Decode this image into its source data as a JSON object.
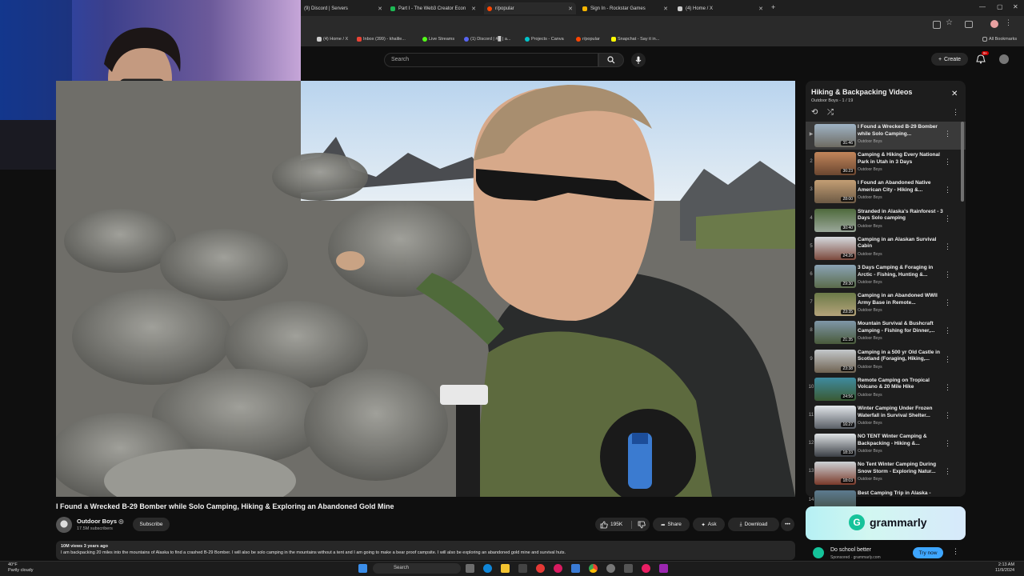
{
  "browser": {
    "tabs": [
      {
        "label": "(9) Discord | Servers",
        "color": "#5865f2"
      },
      {
        "label": "Part I - The Web3 Creator Econ",
        "color": "#1db954"
      },
      {
        "label": "r/popular",
        "color": "#ff4500"
      },
      {
        "label": "Sign In - Rockstar Games",
        "color": "#f7b500"
      },
      {
        "label": "(4) Home / X",
        "color": "#cccccc"
      }
    ],
    "bookmarks": [
      {
        "label": "(4) Home / X"
      },
      {
        "label": "Inbox (399) - khalile..."
      },
      {
        "label": "Live Streams"
      },
      {
        "label": "(1) Discord | #█ | a..."
      },
      {
        "label": "Projects - Canva"
      },
      {
        "label": "r/popular"
      },
      {
        "label": "Snapchat - Say it in..."
      }
    ],
    "all_bookmarks": "All Bookmarks"
  },
  "header": {
    "search_placeholder": "Search",
    "create_label": "Create",
    "notif_count": "9+"
  },
  "video": {
    "title": "I Found a Wrecked B-29 Bomber while Solo Camping, Hiking & Exploring an Abandoned Gold Mine",
    "channel": "Outdoor Boys",
    "subscribers": "17.5M subscribers",
    "subscribe_label": "Subscribe",
    "likes": "195K",
    "share_label": "Share",
    "ask_label": "Ask",
    "download_label": "Download",
    "stats": "10M views  3 years ago",
    "description": "I am backpacking 20 miles into the mountains of Alaska to find a crashed B-29 Bomber. I will also be solo camping in the mountains without a tent and I am going to make a bear proof campsite. I will also be exploring an abandoned gold mine and survival huts."
  },
  "playlist": {
    "title": "Hiking & Backpacking Videos",
    "subtitle": "Outdoor Boys - 1 / 19",
    "items": [
      {
        "num": "▶",
        "title": "I Found a Wrecked B-29 Bomber while Solo Camping...",
        "channel": "Outdoor Boys",
        "duration": "31:46",
        "colors": [
          "#9fb3c5",
          "#6e6b62"
        ]
      },
      {
        "num": "2",
        "title": "Camping & Hiking Every National Park in Utah in 3 Days",
        "channel": "Outdoor Boys",
        "duration": "36:23",
        "colors": [
          "#c2865b",
          "#6a4630"
        ]
      },
      {
        "num": "3",
        "title": "I Found an Abandoned Native American City - Hiking &...",
        "channel": "Outdoor Boys",
        "duration": "28:00",
        "colors": [
          "#c39e74",
          "#6d5a45"
        ]
      },
      {
        "num": "4",
        "title": "Stranded in Alaska's Rainforest - 3 Days Solo camping",
        "channel": "Outdoor Boys",
        "duration": "30:40",
        "colors": [
          "#4f6a3c",
          "#9aa79a"
        ]
      },
      {
        "num": "5",
        "title": "Camping in an Alaskan Survival Cabin",
        "channel": "Outdoor Boys",
        "duration": "24:26",
        "colors": [
          "#d5d9de",
          "#7c4a3d"
        ]
      },
      {
        "num": "6",
        "title": "3 Days Camping & Foraging in Arctic - Fishing, Hunting &...",
        "channel": "Outdoor Boys",
        "duration": "29:30",
        "colors": [
          "#8aa3b5",
          "#5b6b4b"
        ]
      },
      {
        "num": "7",
        "title": "Camping in an Abandoned WWII Army Base in Remote...",
        "channel": "Outdoor Boys",
        "duration": "23:35",
        "colors": [
          "#6b7a48",
          "#b5a37a"
        ]
      },
      {
        "num": "8",
        "title": "Mountain Survival & Bushcraft Camping - Fishing for Dinner,...",
        "channel": "Outdoor Boys",
        "duration": "21:35",
        "colors": [
          "#7f96a8",
          "#495a3a"
        ]
      },
      {
        "num": "9",
        "title": "Camping in a 500 yr Old Castle in Scotland (Foraging, Hiking,...",
        "channel": "Outdoor Boys",
        "duration": "23:38",
        "colors": [
          "#c3c7ca",
          "#6f6352"
        ]
      },
      {
        "num": "10",
        "title": "Remote Camping on Tropical Volcano & 20 Mile Hike",
        "channel": "Outdoor Boys",
        "duration": "24:56",
        "colors": [
          "#3f8ba0",
          "#3a5a33"
        ]
      },
      {
        "num": "11",
        "title": "Winter Camping Under Frozen Waterfall in Survival Shelter...",
        "channel": "Outdoor Boys",
        "duration": "16:27",
        "colors": [
          "#e2e6ea",
          "#5a5f66"
        ]
      },
      {
        "num": "12",
        "title": "NO TENT Winter Camping & Backpacking - Hiking &...",
        "channel": "Outdoor Boys",
        "duration": "18:33",
        "colors": [
          "#dfe3e6",
          "#3b3f45"
        ]
      },
      {
        "num": "13",
        "title": "No Tent Winter Camping During Snow Storm - Exploring Natur...",
        "channel": "Outdoor Boys",
        "duration": "18:03",
        "colors": [
          "#cdd2d6",
          "#7a3a2a"
        ]
      },
      {
        "num": "14",
        "title": "Best Camping Trip in Alaska -",
        "channel": "",
        "duration": "",
        "colors": [
          "#5d7b8f",
          "#404a3d"
        ]
      }
    ]
  },
  "ad": {
    "brand": "grammarly",
    "headline": "Do school better",
    "sponsor": "Sponsored · grammarly.com",
    "cta": "Try now"
  },
  "taskbar": {
    "temp": "40°F",
    "weather": "Partly cloudy",
    "search": "Search",
    "time": "2:13 AM",
    "date": "11/9/2024"
  }
}
